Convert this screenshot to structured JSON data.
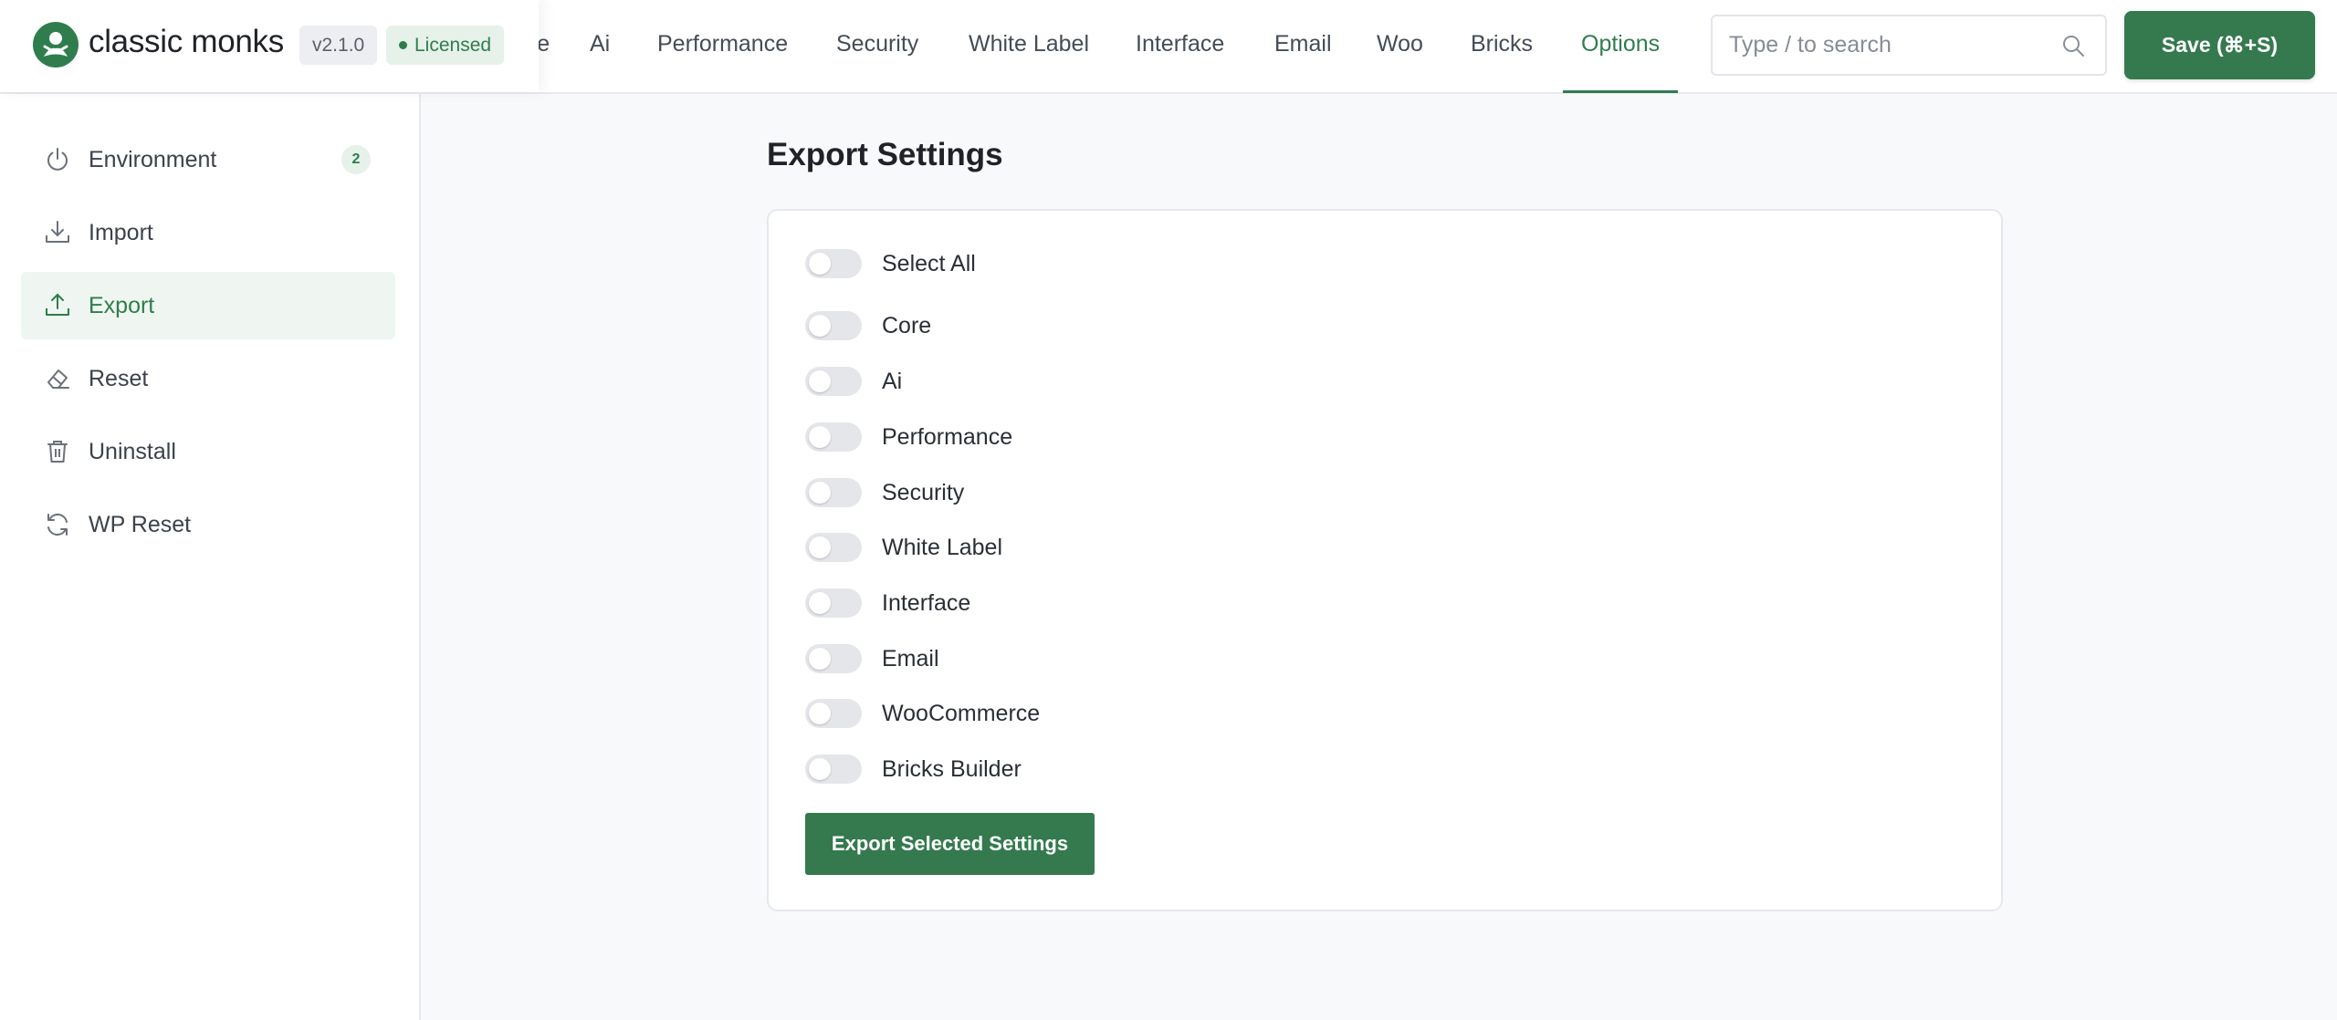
{
  "brand": {
    "name": "classic monks",
    "version": "v2.1.0",
    "license_status": "Licensed",
    "accent_color": "#2f7d4c"
  },
  "nav": {
    "tabs": [
      {
        "label": "Core"
      },
      {
        "label": "Ai"
      },
      {
        "label": "Performance"
      },
      {
        "label": "Security"
      },
      {
        "label": "White Label"
      },
      {
        "label": "Interface"
      },
      {
        "label": "Email"
      },
      {
        "label": "Woo"
      },
      {
        "label": "Bricks"
      },
      {
        "label": "Options",
        "active": true
      }
    ]
  },
  "search": {
    "placeholder": "Type / to search",
    "icon": "search-icon"
  },
  "save_button": {
    "label": "Save (⌘+S)"
  },
  "sidebar": {
    "items": [
      {
        "label": "Environment",
        "icon": "power-icon",
        "count": "2"
      },
      {
        "label": "Import",
        "icon": "download-icon"
      },
      {
        "label": "Export",
        "icon": "upload-icon",
        "active": true
      },
      {
        "label": "Reset",
        "icon": "eraser-icon"
      },
      {
        "label": "Uninstall",
        "icon": "trash-icon"
      },
      {
        "label": "WP Reset",
        "icon": "refresh-icon"
      }
    ]
  },
  "main": {
    "title": "Export Settings",
    "select_all": {
      "label": "Select All",
      "checked": false
    },
    "options": [
      {
        "label": "Core",
        "checked": false
      },
      {
        "label": "Ai",
        "checked": false
      },
      {
        "label": "Performance",
        "checked": false
      },
      {
        "label": "Security",
        "checked": false
      },
      {
        "label": "White Label",
        "checked": false
      },
      {
        "label": "Interface",
        "checked": false
      },
      {
        "label": "Email",
        "checked": false
      },
      {
        "label": "WooCommerce",
        "checked": false
      },
      {
        "label": "Bricks Builder",
        "checked": false
      }
    ],
    "export_button": "Export Selected Settings"
  }
}
